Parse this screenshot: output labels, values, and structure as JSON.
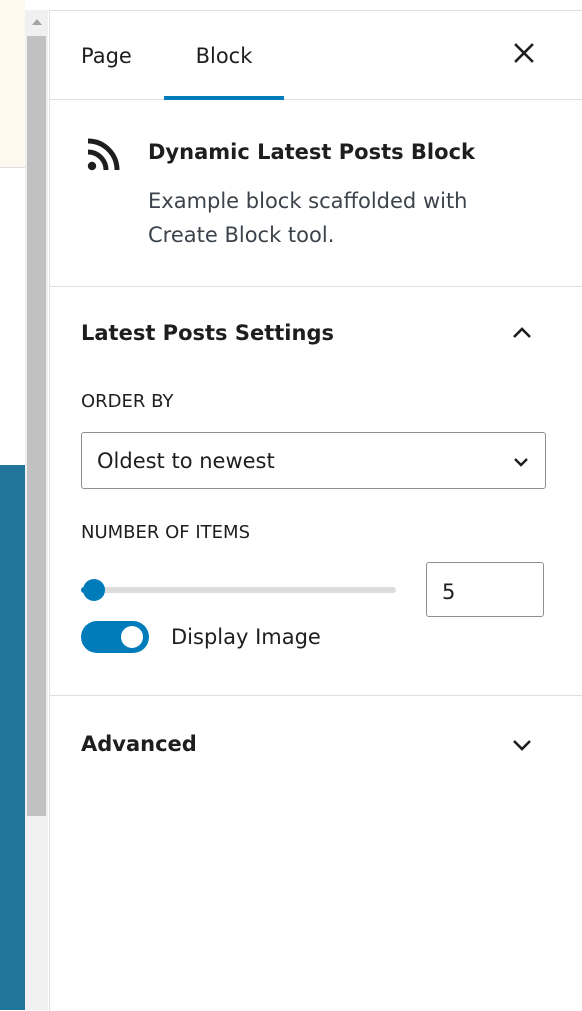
{
  "colors": {
    "accent": "#007cba",
    "editor_block_bg": "#21759b",
    "notice_bg": "#fef8ee"
  },
  "tabs": [
    {
      "label": "Page"
    },
    {
      "label": "Block",
      "active": true
    }
  ],
  "close_icon": "close-icon",
  "block_card": {
    "icon": "rss-icon",
    "title": "Dynamic Latest Posts Block",
    "description": "Example block scaffolded with Create Block tool."
  },
  "panel": {
    "title": "Latest Posts Settings",
    "expanded": true,
    "order_by": {
      "label": "ORDER BY",
      "value": "Oldest to newest"
    },
    "number_of_items": {
      "label": "NUMBER OF ITEMS",
      "value": "5",
      "slider_fraction": 0.04
    },
    "display_image": {
      "label": "Display Image",
      "checked": true
    }
  },
  "advanced": {
    "title": "Advanced",
    "expanded": false
  }
}
